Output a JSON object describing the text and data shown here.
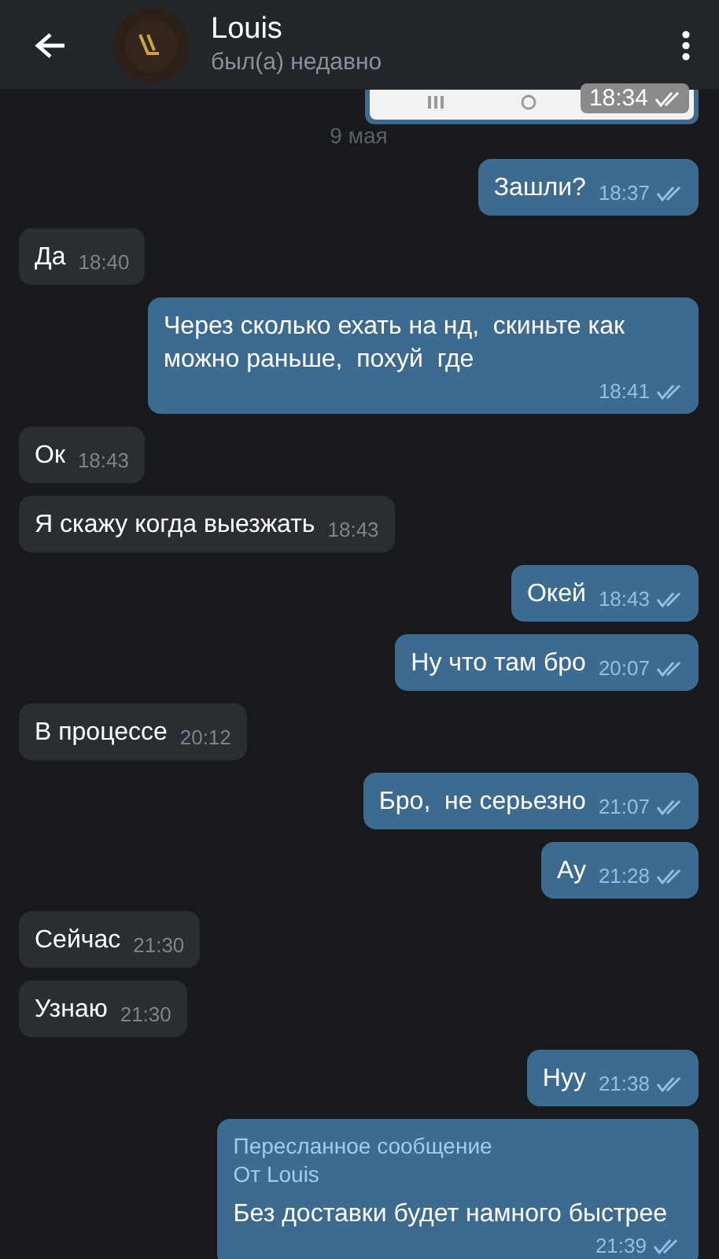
{
  "header": {
    "name": "Louis",
    "status": "был(а) недавно"
  },
  "image_message": {
    "kind": "picture",
    "time": "18:34",
    "read": true
  },
  "date_separator": "9 мая",
  "messages": [
    {
      "outgoing": true,
      "text": "Зашли?",
      "time": "18:37",
      "read": true
    },
    {
      "outgoing": false,
      "text": "Да",
      "time": "18:40"
    },
    {
      "outgoing": true,
      "text": "Через сколько ехать на нд,  скиньте как можно раньше,  похуй  где",
      "time": "18:41",
      "read": true
    },
    {
      "outgoing": false,
      "text": "Ок",
      "time": "18:43"
    },
    {
      "outgoing": false,
      "text": "Я скажу когда выезжать",
      "time": "18:43"
    },
    {
      "outgoing": true,
      "text": "Окей",
      "time": "18:43",
      "read": true
    },
    {
      "outgoing": true,
      "text": "Ну что там бро",
      "time": "20:07",
      "read": true
    },
    {
      "outgoing": false,
      "text": "В процессе",
      "time": "20:12"
    },
    {
      "outgoing": true,
      "text": "Бро,  не серьезно",
      "time": "21:07",
      "read": true
    },
    {
      "outgoing": true,
      "text": "Ау",
      "time": "21:28",
      "read": true
    },
    {
      "outgoing": false,
      "text": "Сейчас",
      "time": "21:30"
    },
    {
      "outgoing": false,
      "text": "Узнаю",
      "time": "21:30"
    },
    {
      "outgoing": true,
      "text": "Нуу",
      "time": "21:38",
      "read": true
    },
    {
      "outgoing": true,
      "forwarded_label": "Пересланное сообщение",
      "forwarded_from": "От Louis",
      "text": "Без доставки будет намного быстрее",
      "time": "21:39",
      "read": true
    }
  ]
}
